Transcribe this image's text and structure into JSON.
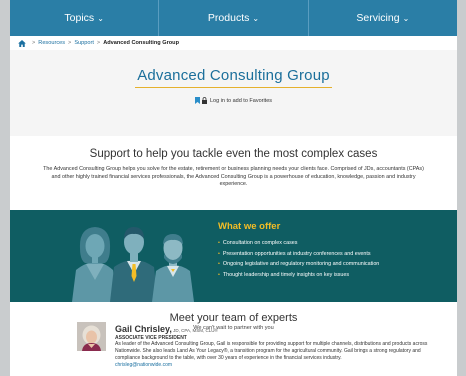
{
  "nav": {
    "items": [
      {
        "label": "Topics",
        "chevron": "⌄"
      },
      {
        "label": "Products",
        "chevron": "⌄"
      },
      {
        "label": "Servicing",
        "chevron": "⌄"
      }
    ]
  },
  "breadcrumb": {
    "items": [
      "Resources",
      "Support"
    ],
    "separator": ">",
    "current": "Advanced Consulting Group"
  },
  "hero": {
    "title": "Advanced Consulting Group",
    "favorite_label": "Log in to add to Favorites"
  },
  "support": {
    "heading": "Support to help you tackle even the most complex cases",
    "body": "The Advanced Consulting Group helps you solve for the estate, retirement or business planning needs your clients face. Comprised of JDs, accountants (CPAs) and other highly trained financial services professionals, the Advanced Consulting Group is a powerhouse of education, knowledge, passion and industry experience."
  },
  "offer": {
    "heading": "What we offer",
    "items": [
      "Consultation on complex cases",
      "Presentation opportunities at industry conferences and events",
      "Ongoing legislative and regulatory monitoring and communication",
      "Thought leadership and timely insights on key issues"
    ],
    "bullet": "•"
  },
  "team": {
    "heading": "Meet your team of experts",
    "subheading": "We can't wait to partner with you"
  },
  "expert": {
    "name": "Gail Chrisley,",
    "credentials": " JD, CPA, MSM, CLU®",
    "role": "ASSOCIATE VICE PRESIDENT",
    "bio": "As leader of the Advanced Consulting Group, Gail is responsible for providing support for multiple channels, distributions and products across Nationwide. She also leads Land As Your Legacy®, a transition program for the agricultural community. Gail brings a strong regulatory and compliance background to the table, with over 30 years of experience in the financial services industry.",
    "email": "chrisleg@nationwide.com"
  },
  "colors": {
    "nav": "#2a7ea6",
    "accent": "#e5b12d",
    "teal": "#0f5d62",
    "link": "#1a6fa0"
  },
  "icons": {
    "home": "home-icon",
    "bookmark": "bookmark-icon",
    "lock": "lock-icon"
  }
}
